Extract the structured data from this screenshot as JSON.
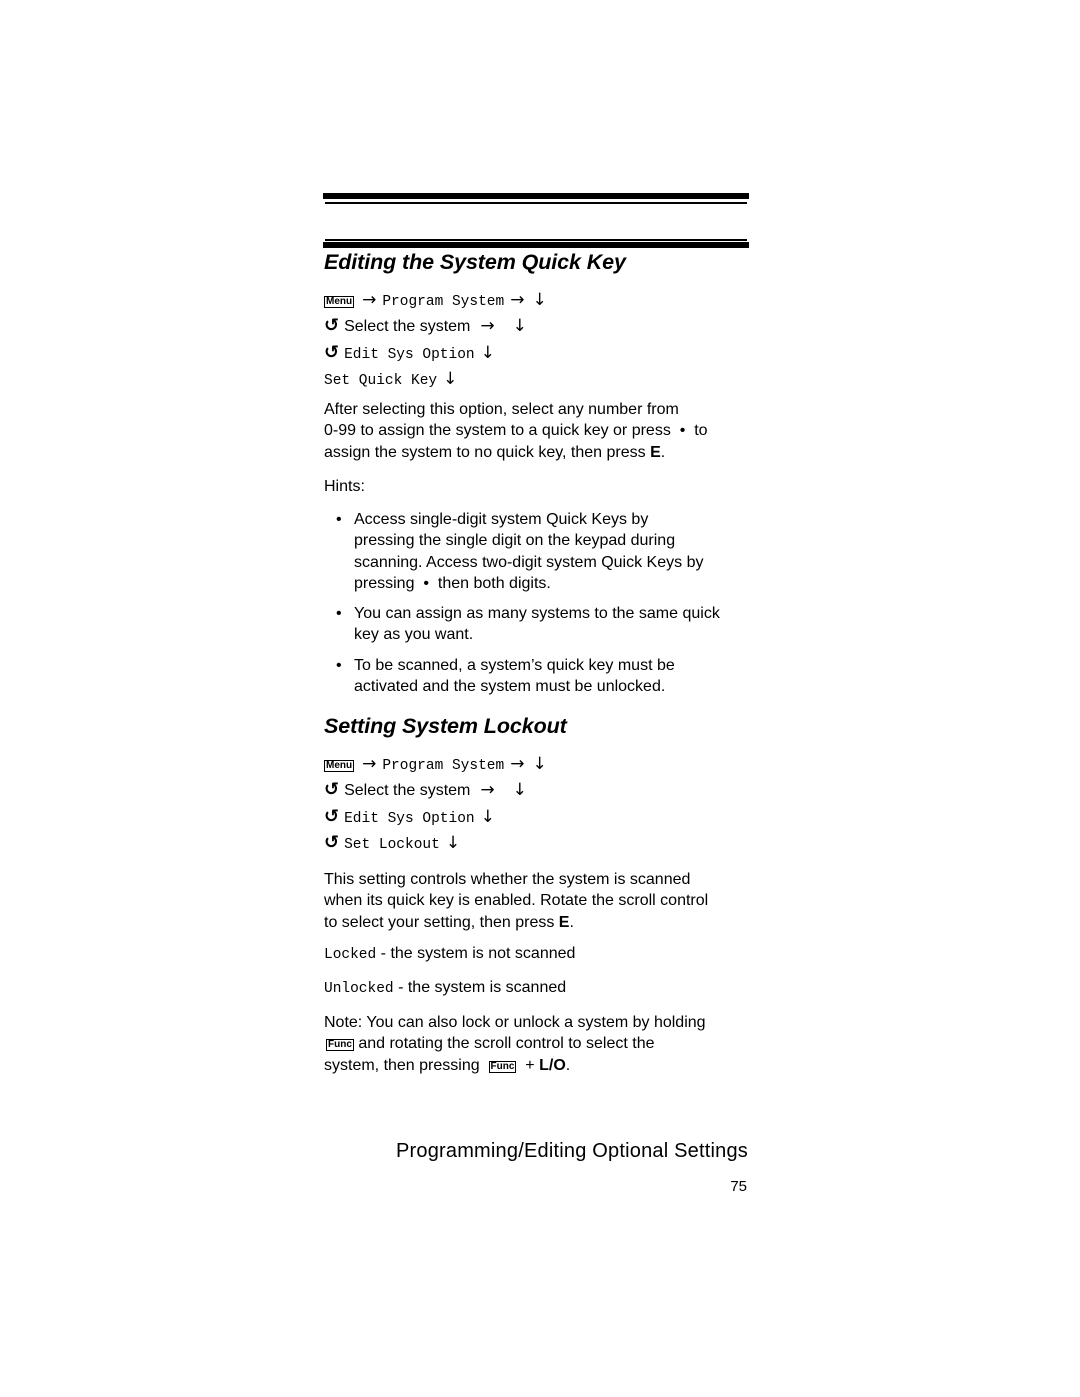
{
  "section1": {
    "title": "Editing the System Quick Key",
    "path": {
      "menu_key": "Menu",
      "step1": "Program System",
      "step2": "Select the system",
      "step3": "Edit Sys Option",
      "step4": "Set Quick Key"
    },
    "body": {
      "p1": "After selecting this option, select any number from",
      "p2a": "0-99 to assign the system to a quick key or press",
      "p2b": "to",
      "p3a": "assign the system to no quick key, then press",
      "p3key": "E",
      "p3end": "."
    },
    "hints_label": "Hints:",
    "hints": [
      {
        "line1": "Access single-digit system Quick Keys by",
        "line2": "pressing the single digit on the keypad during",
        "line3": "scanning. Access two-digit system Quick Keys by",
        "line4a": "pressing",
        "line4b": "then both digits."
      },
      {
        "text": "You can assign as many systems to the same quick key as you want."
      },
      {
        "text": "To be scanned, a system’s quick key must be activated and the system must be unlocked."
      }
    ]
  },
  "section2": {
    "title": "Setting System Lockout",
    "path": {
      "menu_key": "Menu",
      "step1": "Program System",
      "step2": "Select the system",
      "step3": "Edit Sys Option",
      "step4": "Set Lockout"
    },
    "body": {
      "p1": "This setting controls whether the system is scanned",
      "p2": "when its quick key is enabled. Rotate the scroll control",
      "p3a": "to select your setting, then press",
      "p3key": "E",
      "p3end": "."
    },
    "options": [
      {
        "value": "Locked",
        "desc": " - the system is not scanned"
      },
      {
        "value": "Unlocked",
        "desc": " - the system is scanned"
      }
    ],
    "note": {
      "line1": "Note: You can also lock or unlock a system by holding",
      "func_key": "Func",
      "line2": " and rotating the scroll control to select the",
      "line3a": "system, then pressing",
      "plus": " + ",
      "lo_key": "L/O",
      "end": "."
    }
  },
  "symbols": {
    "arrow_right": "→",
    "arrow_down": "↓",
    "rotate": "↺",
    "dot": "•",
    "bullet": "•"
  },
  "footer": {
    "chapter": "Programming/Editing Optional Settings",
    "page_number": "75"
  }
}
